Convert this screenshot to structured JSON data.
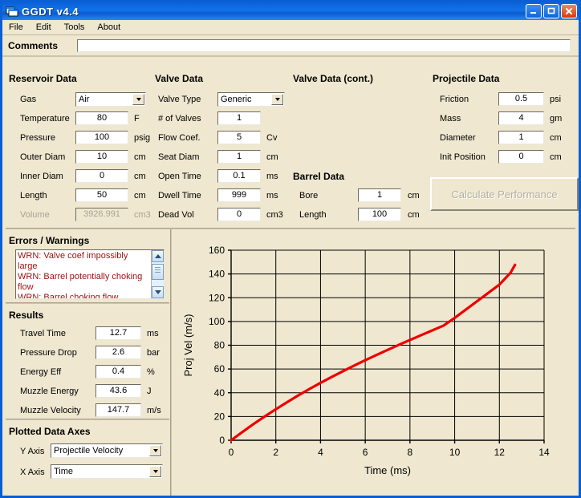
{
  "window": {
    "title": "GGDT v4.4",
    "icon": "app-window-icon",
    "minimize": "_",
    "maximize": "❐",
    "close": "✕"
  },
  "menu": [
    {
      "label": "File"
    },
    {
      "label": "Edit"
    },
    {
      "label": "Tools"
    },
    {
      "label": "About"
    }
  ],
  "comments": {
    "label": "Comments",
    "value": "",
    "placeholder": ""
  },
  "reservoir": {
    "title": "Reservoir Data",
    "fields": [
      {
        "label": "Gas",
        "value": "Air",
        "unit": "",
        "type": "combo",
        "disabled": false
      },
      {
        "label": "Temperature",
        "value": "80",
        "unit": "F",
        "type": "text",
        "disabled": false
      },
      {
        "label": "Pressure",
        "value": "100",
        "unit": "psig",
        "type": "text",
        "disabled": false
      },
      {
        "label": "Outer Diam",
        "value": "10",
        "unit": "cm",
        "type": "text",
        "disabled": false
      },
      {
        "label": "Inner Diam",
        "value": "0",
        "unit": "cm",
        "type": "text",
        "disabled": false
      },
      {
        "label": "Length",
        "value": "50",
        "unit": "cm",
        "type": "text",
        "disabled": false
      },
      {
        "label": "Volume",
        "value": "3926.991",
        "unit": "cm3",
        "type": "text",
        "disabled": true
      }
    ]
  },
  "valve": {
    "title": "Valve Data",
    "fields": [
      {
        "label": "Valve Type",
        "value": "Generic",
        "unit": "",
        "type": "combo",
        "disabled": false
      },
      {
        "label": "# of Valves",
        "value": "1",
        "unit": "",
        "type": "text",
        "disabled": false
      },
      {
        "label": "Flow Coef.",
        "value": "5",
        "unit": "Cv",
        "type": "text",
        "disabled": false
      },
      {
        "label": "Seat Diam",
        "value": "1",
        "unit": "cm",
        "type": "text",
        "disabled": false
      },
      {
        "label": "Open Time",
        "value": "0.1",
        "unit": "ms",
        "type": "text",
        "disabled": false
      },
      {
        "label": "Dwell Time",
        "value": "999",
        "unit": "ms",
        "type": "text",
        "disabled": false
      },
      {
        "label": "Dead Vol",
        "value": "0",
        "unit": "cm3",
        "type": "text",
        "disabled": false
      }
    ]
  },
  "valve_cont": {
    "title": "Valve Data (cont.)"
  },
  "barrel": {
    "title": "Barrel Data",
    "fields": [
      {
        "label": "Bore",
        "value": "1",
        "unit": "cm"
      },
      {
        "label": "Length",
        "value": "100",
        "unit": "cm"
      }
    ]
  },
  "projectile": {
    "title": "Projectile Data",
    "fields": [
      {
        "label": "Friction",
        "value": "0.5",
        "unit": "psi"
      },
      {
        "label": "Mass",
        "value": "4",
        "unit": "gm"
      },
      {
        "label": "Diameter",
        "value": "1",
        "unit": "cm"
      },
      {
        "label": "Init Position",
        "value": "0",
        "unit": "cm"
      }
    ],
    "calculate_label": "Calculate Performance"
  },
  "errors": {
    "title": "Errors / Warnings",
    "color": "#9e1111",
    "items": [
      "WRN: Valve coef impossibly large",
      "WRN: Barrel potentially choking flow",
      "WRN: Barrel choking flow"
    ],
    "scrollbar": {
      "up_icon": "caret-up-icon",
      "down_icon": "caret-down-icon"
    }
  },
  "results": {
    "title": "Results",
    "fields": [
      {
        "label": "Travel Time",
        "value": "12.7",
        "unit": "ms"
      },
      {
        "label": "Pressure Drop",
        "value": "2.6",
        "unit": "bar"
      },
      {
        "label": "Energy Eff",
        "value": "0.4",
        "unit": "%"
      },
      {
        "label": "Muzzle Energy",
        "value": "43.6",
        "unit": "J"
      },
      {
        "label": "Muzzle Velocity",
        "value": "147.7",
        "unit": "m/s"
      }
    ]
  },
  "plotted_axes": {
    "title": "Plotted Data Axes",
    "y_label": "Y Axis",
    "y_value": "Projectile Velocity",
    "x_label": "X Axis",
    "x_value": "Time"
  },
  "chart_data": {
    "type": "line",
    "title": "",
    "xlabel": "Time (ms)",
    "ylabel": "Proj Vel (m/s)",
    "xlim": [
      0,
      14
    ],
    "ylim": [
      0,
      160
    ],
    "xticks": [
      0,
      2,
      4,
      6,
      8,
      10,
      12,
      14
    ],
    "yticks": [
      0,
      20,
      40,
      60,
      80,
      100,
      120,
      140,
      160
    ],
    "grid": true,
    "legend": null,
    "series": [
      {
        "name": "Projectile Velocity",
        "color": "#ee0000",
        "x": [
          0,
          0.5,
          1,
          1.5,
          2,
          2.5,
          3,
          3.5,
          4,
          4.5,
          5,
          5.5,
          6,
          6.5,
          7,
          7.5,
          8,
          8.5,
          9,
          9.5,
          10,
          10.5,
          11,
          11.5,
          12,
          12.5,
          12.7
        ],
        "y": [
          0,
          6.9,
          13.6,
          20.0,
          26.1,
          32.0,
          37.7,
          43.1,
          48.3,
          53.3,
          58.1,
          62.8,
          67.4,
          71.8,
          76.1,
          80.3,
          84.4,
          88.5,
          92.5,
          96.5,
          103.0,
          110.0,
          117.0,
          124.0,
          131.0,
          141.0,
          147.7
        ]
      }
    ]
  }
}
